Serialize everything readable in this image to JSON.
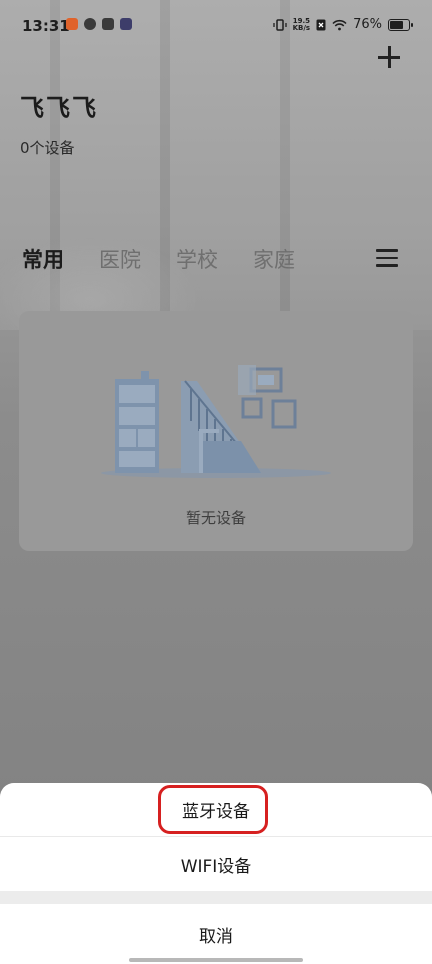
{
  "status_bar": {
    "time": "13:31",
    "net_speed_value": "19.5",
    "net_speed_unit": "KB/s",
    "battery": "76%",
    "battery_level": 0.76
  },
  "header": {
    "home_name": "飞飞飞",
    "device_count": "0个设备"
  },
  "tabs": [
    {
      "label": "常用",
      "active": true
    },
    {
      "label": "医院",
      "active": false
    },
    {
      "label": "学校",
      "active": false
    },
    {
      "label": "家庭",
      "active": false
    }
  ],
  "empty_state": {
    "text": "暂无设备"
  },
  "bottom_sheet": {
    "options": [
      "蓝牙设备",
      "WIFI设备"
    ],
    "cancel": "取消"
  },
  "colors": {
    "highlight": "#d62020"
  }
}
